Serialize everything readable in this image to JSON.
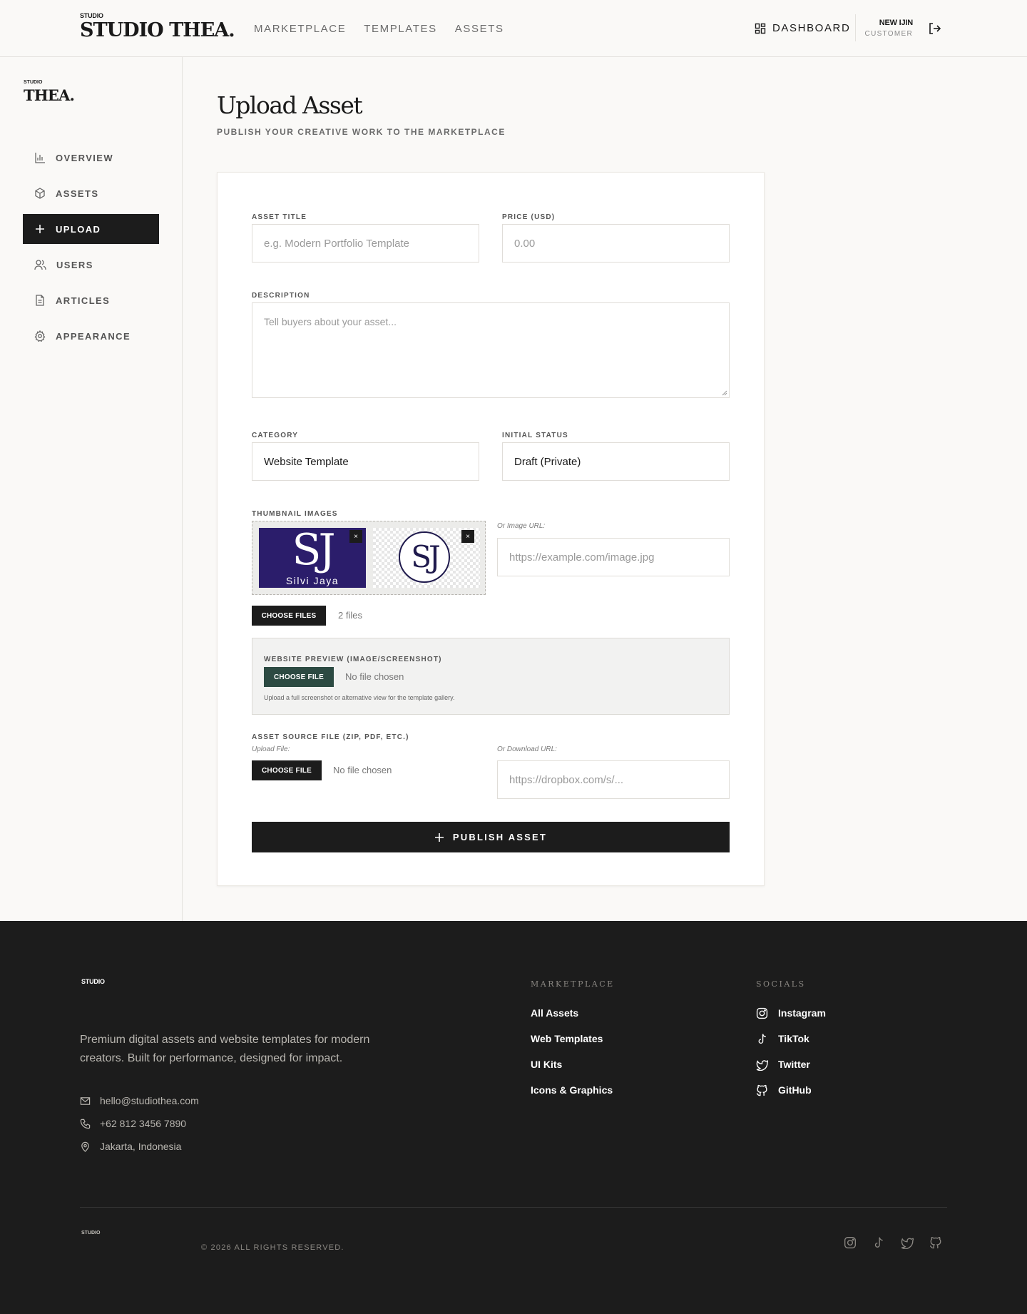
{
  "header": {
    "brand_small": "STUDIO",
    "brand_big": "STUDIO THEA.",
    "nav": [
      "MARKETPLACE",
      "TEMPLATES",
      "ASSETS"
    ],
    "dashboard_label": "DASHBOARD",
    "user_name": "NEW IJIN",
    "user_role": "CUSTOMER"
  },
  "sidebar": {
    "brand_small": "STUDIO",
    "brand_big": "THEA.",
    "items": [
      {
        "label": "OVERVIEW",
        "icon": "chart-icon"
      },
      {
        "label": "ASSETS",
        "icon": "box-icon"
      },
      {
        "label": "UPLOAD",
        "icon": "plus-icon",
        "active": true
      },
      {
        "label": "USERS",
        "icon": "users-icon"
      },
      {
        "label": "ARTICLES",
        "icon": "document-icon"
      },
      {
        "label": "APPEARANCE",
        "icon": "gear-icon"
      }
    ]
  },
  "page": {
    "title": "Upload Asset",
    "subtitle": "PUBLISH YOUR CREATIVE WORK TO THE MARKETPLACE"
  },
  "form": {
    "asset_title_label": "ASSET TITLE",
    "asset_title_placeholder": "e.g. Modern Portfolio Template",
    "price_label": "PRICE (USD)",
    "price_placeholder": "0.00",
    "description_label": "DESCRIPTION",
    "description_placeholder": "Tell buyers about your asset...",
    "category_label": "CATEGORY",
    "category_value": "Website Template",
    "status_label": "INITIAL STATUS",
    "status_value": "Draft (Private)",
    "thumbnails_label": "THUMBNAIL IMAGES",
    "thumb1_text": "SJ",
    "thumb1_name": "Silvi Jaya",
    "thumb2_text": "SJ",
    "remove_glyph": "×",
    "image_url_label": "Or Image URL:",
    "image_url_placeholder": "https://example.com/image.jpg",
    "choose_files_label": "CHOOSE FILES",
    "files_status": "2 files",
    "preview_label": "WEBSITE PREVIEW (IMAGE/SCREENSHOT)",
    "preview_choose_label": "CHOOSE FILE",
    "preview_status": "No file chosen",
    "preview_help": "Upload a full screenshot or alternative view for the template gallery.",
    "source_label": "ASSET SOURCE FILE (ZIP, PDF, ETC.)",
    "upload_file_label": "Upload File:",
    "source_choose_label": "CHOOSE FILE",
    "source_status": "No file chosen",
    "download_url_label": "Or Download URL:",
    "download_url_placeholder": "https://dropbox.com/s/...",
    "publish_label": "PUBLISH ASSET"
  },
  "footer": {
    "brand": "STUDIO",
    "tagline": "Premium digital assets and website templates for modern creators. Built for performance, designed for impact.",
    "email": "hello@studiothea.com",
    "phone": "+62 812 3456 7890",
    "location": "Jakarta, Indonesia",
    "marketplace_heading": "MARKETPLACE",
    "marketplace_links": [
      "All Assets",
      "Web Templates",
      "UI Kits",
      "Icons & Graphics"
    ],
    "socials_heading": "SOCIALS",
    "social_links": [
      "Instagram",
      "TikTok",
      "Twitter",
      "GitHub"
    ],
    "brand_small": "STUDIO",
    "copyright": "© 2026 ALL RIGHTS RESERVED."
  },
  "colors": {
    "accent_dark": "#1c1c1c",
    "preview_button": "#2c4a42",
    "thumb_bg": "#2b1d6b"
  }
}
